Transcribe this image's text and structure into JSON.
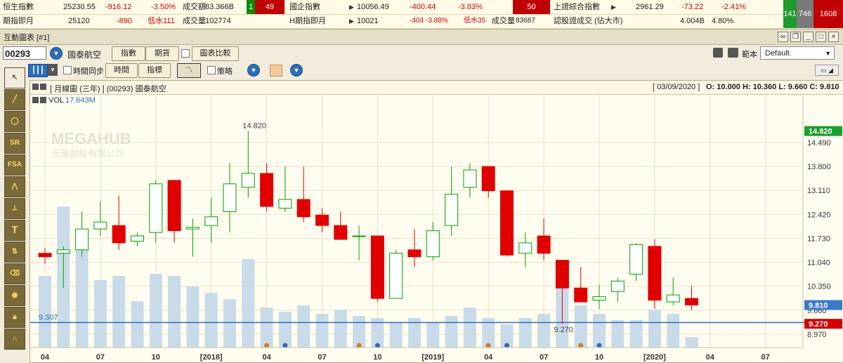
{
  "ticker": {
    "row1": {
      "hsi_label": "恒生指數",
      "hsi_value": "25230.55",
      "hsi_change": "-916.12",
      "hsi_pct": "-3.50%",
      "turnover_label": "成交額",
      "turnover_value": "83.366B",
      "box_up": "1",
      "box_down": "49",
      "hscei_label": "國企指數",
      "hscei_value": "10056.49",
      "hscei_change": "-400.44",
      "hscei_pct": "-3.83%",
      "box_hscei": "50",
      "sse_label": "上證綜合指數",
      "sse_value": "2961.29",
      "sse_change": "-73.22",
      "sse_pct": "-2.41%"
    },
    "row2": {
      "fut_label": "期指即月",
      "fut_value": "25120",
      "fut_change": "-890",
      "fut_discount": "低水111",
      "fut_vol_label": "成交量",
      "fut_vol_value": "102774",
      "hfut_label": "H期指即月",
      "hfut_value": "10021",
      "hfut_change": "-404",
      "hfut_pct": "-3.88%",
      "hfut_discount": "低水35",
      "hfut_vol_label": "成交量",
      "hfut_vol_value": "83687",
      "warrant_label": "認股證成交 (佔大市)",
      "warrant_value": "4.004B",
      "warrant_pct": "4.80%"
    },
    "boxes": [
      "141",
      "746",
      "1608"
    ]
  },
  "window": {
    "title": "互動圖表 [#1]"
  },
  "toolbar1": {
    "code": "00293",
    "stock_name": "國泰航空",
    "btn_index": "指數",
    "btn_futures": "期貨",
    "btn_compare": "圖表比較",
    "template_label": "範本",
    "template_value": "Default"
  },
  "toolbar2": {
    "sync_label": "時間同步",
    "btn_time": "時間",
    "btn_indicator": "指標",
    "strategy_label": "策略"
  },
  "sidebar": {
    "tools": [
      "pointer-icon",
      "trendline-icon",
      "ellipse-icon",
      "sr-icon",
      "fsa-icon",
      "fan-icon",
      "measure-icon",
      "text-icon",
      "scale-icon",
      "eraser-icon",
      "eye-icon",
      "lock-icon",
      "magnet-icon"
    ],
    "labels": {
      "sr": "SR",
      "fsa": "FSA",
      "text": "T"
    }
  },
  "chart_header": {
    "title": "[ 月線圖 (三年) ]  (00293)  國泰航空",
    "date": "[ 03/09/2020 ]",
    "ohlc": "O: 10.000  H: 10.360  L: 9.660  C: 9.810",
    "vol_label": "VOL",
    "vol_value": "17.643M"
  },
  "colors": {
    "up": "#00a000",
    "down": "#e00000",
    "vol": "#c9dbe9",
    "hline": "#2e6db8",
    "accent": "#2e6db8"
  },
  "chart_data": {
    "type": "candlestick",
    "title": "[ 月線圖 (三年) ]  (00293)  國泰航空",
    "watermark": [
      "MEGAHUB",
      "天滙財經有限公司"
    ],
    "ylim": [
      8.97,
      15.5
    ],
    "y_ticks": [
      "14.490",
      "13.800",
      "13.110",
      "12.420",
      "11.730",
      "11.040",
      "10.350",
      "9.660",
      "8.970"
    ],
    "x_labels": [
      "04",
      "07",
      "10",
      "[2018]",
      "04",
      "07",
      "10",
      "[2019]",
      "04",
      "07",
      "10",
      "[2020]",
      "04",
      "07"
    ],
    "x_label_months": [
      0,
      3,
      6,
      9,
      12,
      15,
      18,
      21,
      24,
      27,
      30,
      33,
      36,
      39
    ],
    "price_tags": [
      {
        "value": 14.82,
        "text": "14.820",
        "color": "#1a9e2e"
      },
      {
        "value": 9.81,
        "text": "9.810",
        "color": "#3a78c8"
      },
      {
        "value": 9.27,
        "text": "9.270",
        "color": "#d40000"
      }
    ],
    "hline": {
      "value": 9.307,
      "label": "9.307"
    },
    "high_label": {
      "text": "14.820",
      "month": 11
    },
    "low_label": {
      "text": "9.270",
      "month": 28
    },
    "candles": [
      {
        "o": 11.3,
        "h": 11.45,
        "l": 11.0,
        "c": 11.2
      },
      {
        "o": 11.3,
        "h": 11.5,
        "l": 10.3,
        "c": 11.4
      },
      {
        "o": 11.4,
        "h": 12.5,
        "l": 11.2,
        "c": 12.0
      },
      {
        "o": 12.0,
        "h": 12.8,
        "l": 11.8,
        "c": 12.2
      },
      {
        "o": 12.1,
        "h": 12.95,
        "l": 11.4,
        "c": 11.6
      },
      {
        "o": 11.65,
        "h": 11.9,
        "l": 11.5,
        "c": 11.8
      },
      {
        "o": 11.9,
        "h": 13.4,
        "l": 11.6,
        "c": 13.3
      },
      {
        "o": 13.4,
        "h": 13.4,
        "l": 11.6,
        "c": 11.95
      },
      {
        "o": 12.0,
        "h": 12.3,
        "l": 11.2,
        "c": 12.05
      },
      {
        "o": 12.1,
        "h": 12.9,
        "l": 11.6,
        "c": 12.35
      },
      {
        "o": 12.5,
        "h": 13.9,
        "l": 11.9,
        "c": 13.3
      },
      {
        "o": 13.2,
        "h": 14.82,
        "l": 12.9,
        "c": 13.6
      },
      {
        "o": 13.6,
        "h": 13.9,
        "l": 12.5,
        "c": 12.65
      },
      {
        "o": 12.6,
        "h": 13.8,
        "l": 12.5,
        "c": 12.85
      },
      {
        "o": 12.85,
        "h": 13.8,
        "l": 12.2,
        "c": 12.35
      },
      {
        "o": 12.4,
        "h": 12.6,
        "l": 11.9,
        "c": 12.1
      },
      {
        "o": 12.1,
        "h": 12.5,
        "l": 11.7,
        "c": 11.7
      },
      {
        "o": 11.8,
        "h": 12.1,
        "l": 11.1,
        "c": 11.8
      },
      {
        "o": 11.8,
        "h": 11.8,
        "l": 9.9,
        "c": 10.0
      },
      {
        "o": 10.0,
        "h": 11.4,
        "l": 10.0,
        "c": 11.3
      },
      {
        "o": 11.4,
        "h": 12.0,
        "l": 10.9,
        "c": 11.2
      },
      {
        "o": 11.2,
        "h": 12.2,
        "l": 11.1,
        "c": 11.95
      },
      {
        "o": 12.1,
        "h": 13.8,
        "l": 11.8,
        "c": 13.0
      },
      {
        "o": 13.2,
        "h": 13.9,
        "l": 12.9,
        "c": 13.7
      },
      {
        "o": 13.8,
        "h": 13.8,
        "l": 12.9,
        "c": 13.1
      },
      {
        "o": 13.1,
        "h": 13.1,
        "l": 11.2,
        "c": 11.25
      },
      {
        "o": 11.3,
        "h": 11.9,
        "l": 10.9,
        "c": 11.6
      },
      {
        "o": 11.8,
        "h": 12.3,
        "l": 11.1,
        "c": 11.3
      },
      {
        "o": 11.1,
        "h": 11.1,
        "l": 9.27,
        "c": 10.3
      },
      {
        "o": 10.3,
        "h": 10.9,
        "l": 9.9,
        "c": 9.9
      },
      {
        "o": 9.95,
        "h": 10.4,
        "l": 9.7,
        "c": 10.05
      },
      {
        "o": 10.2,
        "h": 10.6,
        "l": 9.9,
        "c": 10.5
      },
      {
        "o": 10.7,
        "h": 11.6,
        "l": 10.5,
        "c": 11.55
      },
      {
        "o": 11.5,
        "h": 11.7,
        "l": 9.7,
        "c": 9.95
      },
      {
        "o": 9.9,
        "h": 10.6,
        "l": 9.8,
        "c": 10.1
      },
      {
        "o": 10.0,
        "h": 10.36,
        "l": 9.66,
        "c": 9.81
      }
    ],
    "volume": [
      0.34,
      0.67,
      0.47,
      0.32,
      0.34,
      0.22,
      0.35,
      0.34,
      0.29,
      0.26,
      0.23,
      0.42,
      0.19,
      0.17,
      0.2,
      0.16,
      0.18,
      0.15,
      0.14,
      0.12,
      0.14,
      0.12,
      0.15,
      0.19,
      0.14,
      0.11,
      0.14,
      0.16,
      0.33,
      0.2,
      0.16,
      0.13,
      0.13,
      0.18,
      0.16,
      0.05
    ],
    "volume_unit": "fraction of panel height",
    "markers": [
      {
        "month": 12,
        "color": "#d07a2a"
      },
      {
        "month": 13,
        "color": "#2e6db8"
      },
      {
        "month": 17,
        "color": "#d07a2a"
      },
      {
        "month": 18,
        "color": "#2e6db8"
      },
      {
        "month": 24,
        "color": "#d07a2a"
      },
      {
        "month": 25,
        "color": "#2e6db8"
      },
      {
        "month": 29,
        "color": "#d07a2a"
      },
      {
        "month": 30,
        "color": "#2e6db8"
      }
    ]
  }
}
